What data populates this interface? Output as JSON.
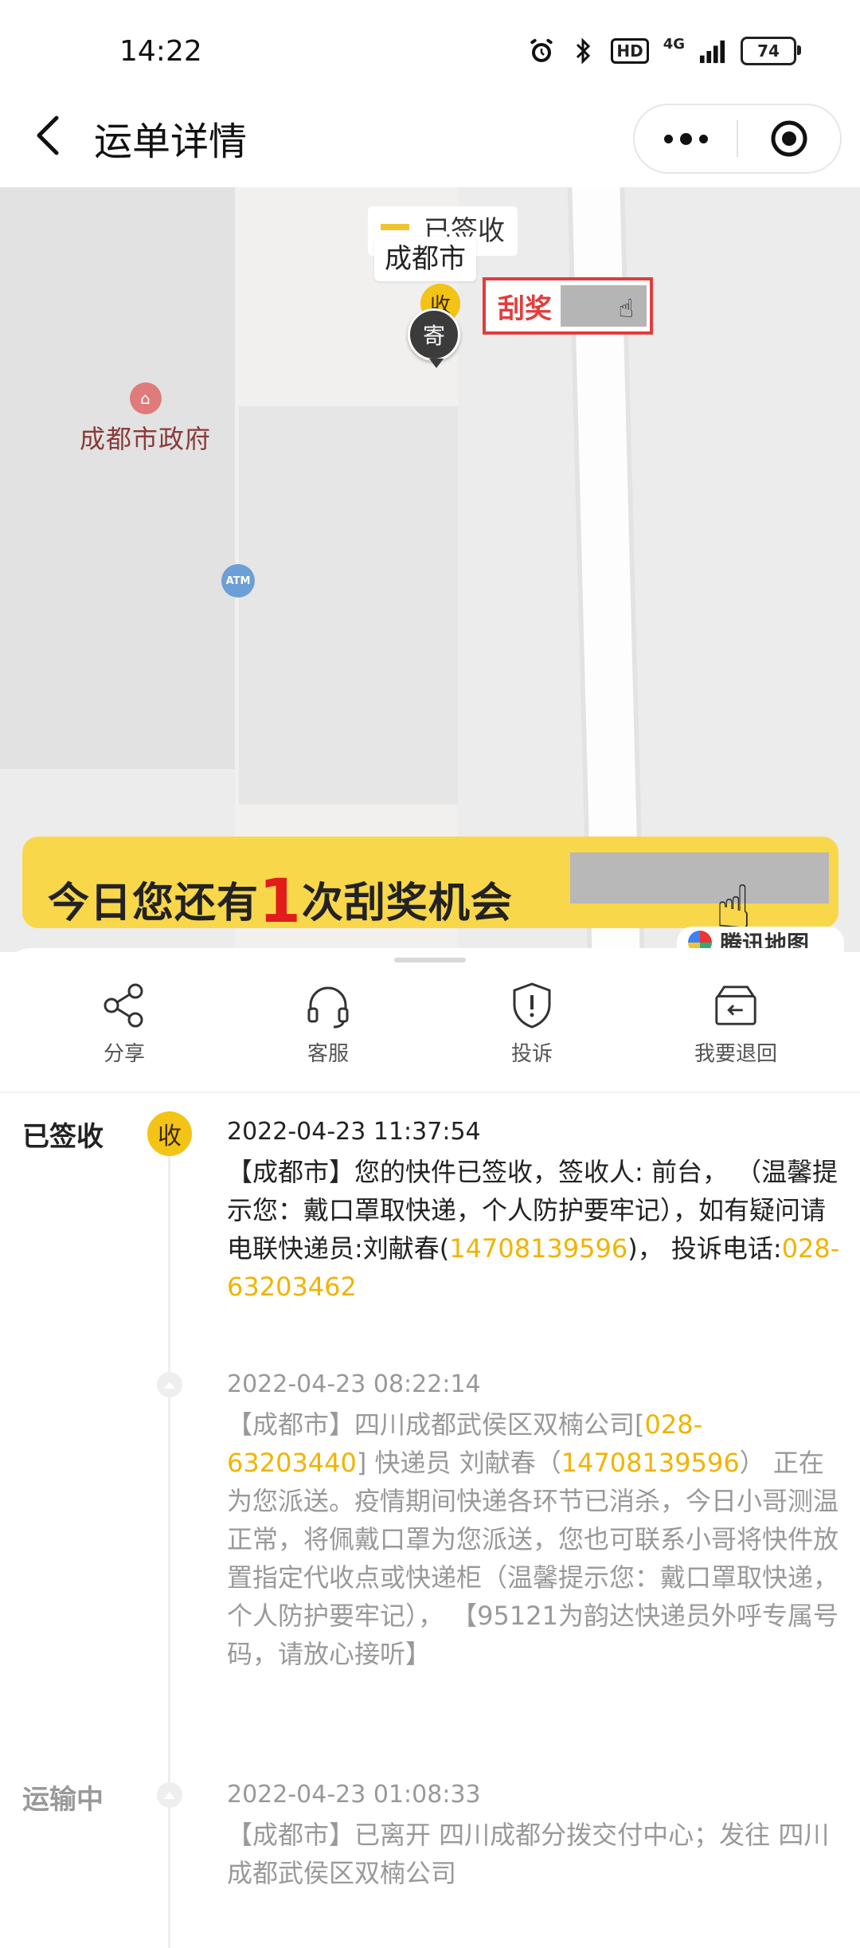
{
  "status_bar": {
    "time": "14:22",
    "hd": "HD",
    "net": "4G",
    "battery": "74"
  },
  "header": {
    "title": "运单详情"
  },
  "map": {
    "bubble_status": "已签收",
    "bubble_city": "成都市",
    "pin_receive": "收",
    "pin_send": "寄",
    "poi_gov": "成都市政府",
    "poi_atm": "ATM",
    "scratch_label": "刮奖",
    "banner": {
      "prefix": "今日您还有",
      "count": "1",
      "suffix": "次刮奖机会"
    },
    "provider": "腾讯地图"
  },
  "actions": [
    {
      "label": "分享",
      "icon": "share-icon"
    },
    {
      "label": "客服",
      "icon": "headset-icon"
    },
    {
      "label": "投诉",
      "icon": "shield-alert-icon"
    },
    {
      "label": "我要退回",
      "icon": "return-box-icon"
    }
  ],
  "timeline": [
    {
      "status": "已签收",
      "node": "收",
      "time": "2022-04-23 11:37:54",
      "text_1": "【成都市】您的快件已签收，签收人: 前台， （温馨提示您：戴口罩取快递，个人防护要牢记），如有疑问请电联快递员:刘献春(",
      "phone_1": "14708139596",
      "text_2": ")， 投诉电话:",
      "phone_2": "028-63203462"
    },
    {
      "status": "",
      "time": "2022-04-23 08:22:14",
      "text_1": "【成都市】四川成都武侯区双楠公司[",
      "phone_1": "028-63203440",
      "text_2": "] 快递员 刘献春（",
      "phone_2": "14708139596",
      "text_3": "） 正在为您派送。疫情期间快递各环节已消杀，今日小哥测温正常，将佩戴口罩为您派送，您也可联系小哥将快件放置指定代收点或快递柜（温馨提示您：戴口罩取快递，个人防护要牢记）， 【95121为韵达快递员外呼专属号码，请放心接听】"
    },
    {
      "status": "运输中",
      "time": "2022-04-23 01:08:33",
      "text_1": "【成都市】已离开 四川成都分拨交付中心；发往 四川成都武侯区双楠公司"
    }
  ],
  "colors": {
    "accent_yellow": "#f3c316",
    "highlight": "#f0b400",
    "scratch_red": "#e23c3c",
    "banner_bg": "#f9d74a"
  }
}
